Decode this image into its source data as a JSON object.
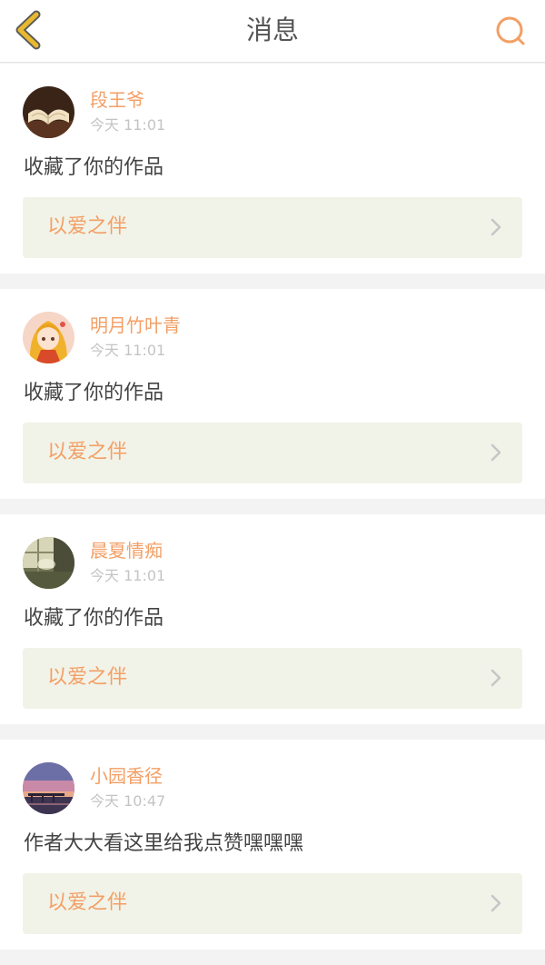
{
  "header": {
    "title": "消息",
    "back_icon": "back-arrow-icon",
    "search_icon": "search-icon",
    "accent_color": "#f39f65",
    "back_color": "#e8b92f"
  },
  "messages": [
    {
      "username": "段王爷",
      "time": "今天 11:01",
      "text": "收藏了你的作品",
      "work_title": "以爱之伴",
      "avatar": "open-book-avatar"
    },
    {
      "username": "明月竹叶青",
      "time": "今天 11:01",
      "text": "收藏了你的作品",
      "work_title": "以爱之伴",
      "avatar": "anime-girl-avatar"
    },
    {
      "username": "晨夏情痴",
      "time": "今天 11:01",
      "text": "收藏了你的作品",
      "work_title": "以爱之伴",
      "avatar": "window-light-avatar"
    },
    {
      "username": "小园香径",
      "time": "今天 10:47",
      "text": "作者大大看这里给我点赞嘿嘿嘿",
      "work_title": "以爱之伴",
      "avatar": "sunset-pier-avatar"
    }
  ]
}
